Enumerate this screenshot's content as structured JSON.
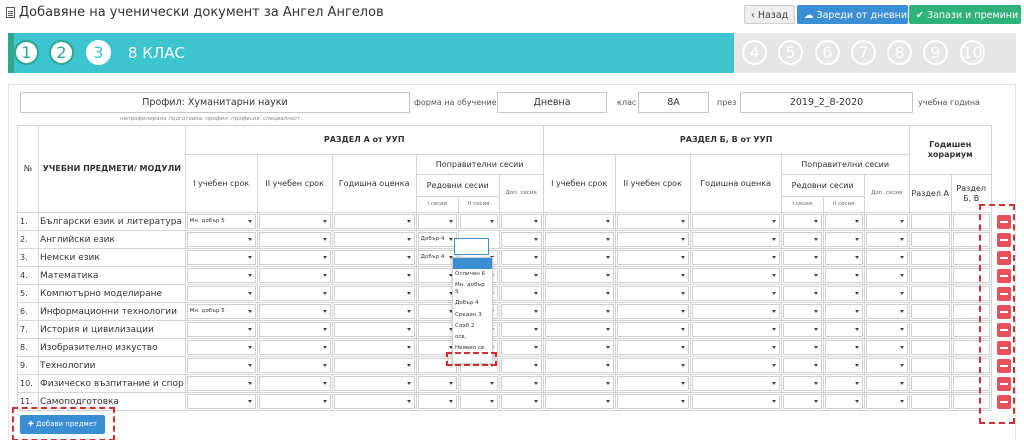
{
  "header": {
    "title": "Добавяне на ученически документ за Ангел Ангелов",
    "back_label": "‹ Назад",
    "load_label": "☁ Зареди от дневник",
    "save_label": "✔ Запази и премини"
  },
  "stepper": {
    "steps": [
      "1",
      "2",
      "3",
      "4",
      "5",
      "6",
      "7",
      "8",
      "9",
      "10"
    ],
    "active_label": "8 КЛАС"
  },
  "profile": {
    "profile_value": "Профил: Хуманитарни науки",
    "profile_hint": "непрофилирана подготовка, профил, професия, специалност..",
    "form_label": "форма на обучение",
    "form_value": "Дневна",
    "class_label": "клас",
    "class_value": "8А",
    "through_label": "през",
    "year_value": "2019_2_8-2020",
    "year_label": "учебна година"
  },
  "table": {
    "col_no": "№",
    "col_subject": "УЧЕБНИ ПРЕДМЕТИ/ МОДУЛИ",
    "section_a": "РАЗДЕЛ А от УУП",
    "section_b": "РАЗДЕЛ Б, В от УУП",
    "annual_hours": "Годишен хорариум",
    "term1": "I учебен срок",
    "term2": "II учебен срок",
    "annual_grade": "Годишна оценка",
    "makeup": "Поправителни сесии",
    "regular": "Редовни сесии",
    "extra": "Доп. сесия",
    "session1": "I сесия",
    "session2": "II сесия",
    "hours_a": "Раздел А",
    "hours_b": "Раздел Б, В",
    "rows": [
      {
        "no": "1.",
        "subject": "Български език и литература",
        "t1": "Мн. добър 5",
        "s1": "",
        "s2": "",
        "s2_open": false
      },
      {
        "no": "2.",
        "subject": "Английски език",
        "t1": "",
        "s1": "Добър 4",
        "s2": "",
        "s2_open": true
      },
      {
        "no": "3.",
        "subject": "Немски език",
        "t1": "",
        "s1": "Добър 4",
        "s2": "",
        "s2_open": false
      },
      {
        "no": "4.",
        "subject": "Математика",
        "t1": "",
        "s1": "",
        "s2": "",
        "s2_open": false
      },
      {
        "no": "5.",
        "subject": "Компютърно моделиране",
        "t1": "",
        "s1": "",
        "s2": "",
        "s2_open": false
      },
      {
        "no": "6.",
        "subject": "Информационни технологии",
        "t1": "Мн. добър 5",
        "s1": "",
        "s2": "",
        "s2_open": false
      },
      {
        "no": "7.",
        "subject": "История и цивилизации",
        "t1": "",
        "s1": "",
        "s2": "",
        "s2_open": false
      },
      {
        "no": "8.",
        "subject": "Изобразително изкуство",
        "t1": "",
        "s1": "",
        "s2": "",
        "s2_open": false
      },
      {
        "no": "9.",
        "subject": "Технологии",
        "t1": "",
        "s1": "",
        "s2": "",
        "s2_open": false
      },
      {
        "no": "10.",
        "subject": "Физическо възпитание и спор",
        "t1": "",
        "s1": "",
        "s2": "",
        "s2_open": false
      },
      {
        "no": "11.",
        "subject": "Самоподготовка",
        "t1": "",
        "s1": "",
        "s2": "",
        "s2_open": false
      }
    ]
  },
  "dropdown": {
    "options": [
      "Отличен 6",
      "Мн. добър 5",
      "Добър 4",
      "Среден 3",
      "Слаб 2",
      "осв.",
      "Неявил се"
    ]
  },
  "add_button_label": "✚ Добави предмет",
  "colors": {
    "accent_teal": "#3cc4cf",
    "primary_blue": "#3a8fd4",
    "success_green": "#2fb27a",
    "danger_red": "#e8505b",
    "highlight_dashes": "#d32f2f"
  }
}
